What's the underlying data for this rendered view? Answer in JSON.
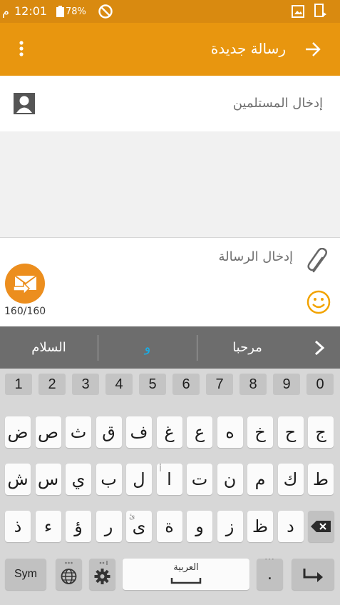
{
  "status_bar": {
    "time": "12:01",
    "ampm": "م",
    "battery": "78%",
    "icons": [
      "dnd-icon",
      "gallery-icon",
      "screen-record-icon"
    ]
  },
  "app_bar": {
    "title": "رسالة جديدة",
    "back_icon": "arrow-right-icon",
    "menu_icon": "more-vert-icon",
    "color": "#e8960f"
  },
  "recipients": {
    "placeholder": "إدخال المستلمين",
    "contact_icon": "contact-icon"
  },
  "compose": {
    "placeholder": "إدخال الرسالة",
    "attach_icon": "paperclip-icon",
    "emoji_icon": "emoji-icon",
    "send_icon": "send-mms-icon",
    "counter": "160/160"
  },
  "suggestions": {
    "items": [
      "السلام",
      "و",
      "مرحبا"
    ],
    "chevron_icon": "chevron-right-icon"
  },
  "keyboard": {
    "numbers": [
      "1",
      "2",
      "3",
      "4",
      "5",
      "6",
      "7",
      "8",
      "9",
      "0"
    ],
    "row1": [
      "ض",
      "ص",
      "ث",
      "ق",
      "ف",
      "غ",
      "ع",
      "ه",
      "خ",
      "ح",
      "ج"
    ],
    "row2": [
      "ش",
      "س",
      "ي",
      "ب",
      "ل",
      "ا",
      "ت",
      "ن",
      "م",
      "ك",
      "ط"
    ],
    "row3": [
      "ذ",
      "ء",
      "ؤ",
      "ر",
      "ى",
      "ة",
      "و",
      "ز",
      "ظ",
      "د"
    ],
    "row2_hints": {
      "ا": "أ"
    },
    "row3_hints": {
      "ى": "ئ"
    },
    "sym_label": "Sym",
    "space_label": "العربية",
    "period": ".",
    "enter_icon": "enter-icon",
    "backspace_icon": "backspace-icon",
    "globe_icon": "globe-icon",
    "settings_icon": "settings-icon"
  }
}
